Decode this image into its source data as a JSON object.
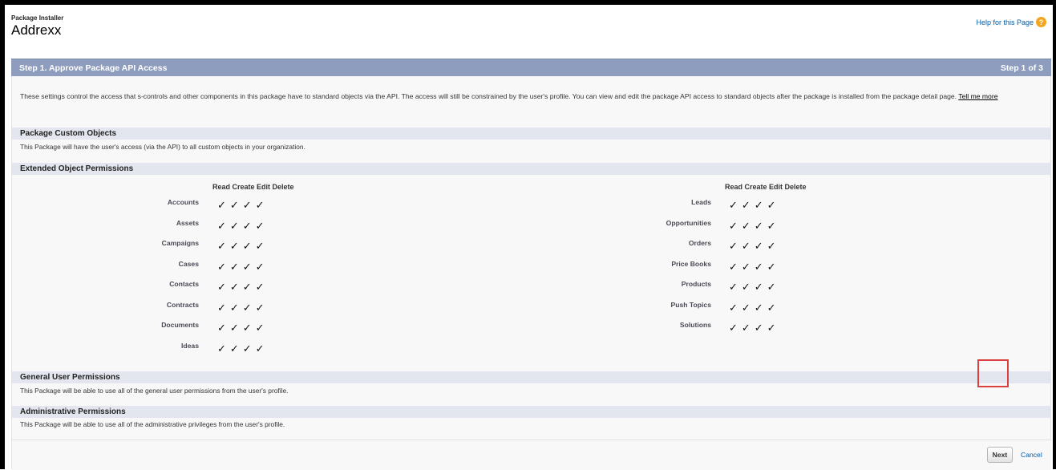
{
  "header": {
    "breadcrumb": "Package Installer",
    "title": "Addrexx",
    "help_link": "Help for this Page",
    "help_icon": "?"
  },
  "step": {
    "label": "Step 1. Approve Package API Access",
    "counter": "Step 1 of 3"
  },
  "intro": {
    "text": "These settings control the access that s-controls and other components in this package have to standard objects via the API. The access will still be constrained by the user's profile. You can view and edit the package API access to standard objects after the package is installed from the package detail page.",
    "link": "Tell me more"
  },
  "sections": {
    "custom_objects": {
      "title": "Package Custom Objects",
      "text": "This Package will have the user's access (via the API) to all custom objects in your organization."
    },
    "extended": {
      "title": "Extended Object Permissions",
      "columns_header": "Read Create Edit Delete"
    },
    "general": {
      "title": "General User Permissions",
      "text": "This Package will be able to use all of the general user permissions from the user's profile."
    },
    "admin": {
      "title": "Administrative Permissions",
      "text": "This Package will be able to use all of the administrative privileges from the user's profile."
    }
  },
  "permissions_left": [
    {
      "name": "Accounts",
      "checks": "✓✓✓✓"
    },
    {
      "name": "Assets",
      "checks": "✓✓✓✓"
    },
    {
      "name": "Campaigns",
      "checks": "✓✓✓✓"
    },
    {
      "name": "Cases",
      "checks": "✓✓✓✓"
    },
    {
      "name": "Contacts",
      "checks": "✓✓✓✓"
    },
    {
      "name": "Contracts",
      "checks": "✓✓✓✓"
    },
    {
      "name": "Documents",
      "checks": "✓✓✓✓"
    },
    {
      "name": "Ideas",
      "checks": "✓✓✓✓"
    }
  ],
  "permissions_right": [
    {
      "name": "Leads",
      "checks": "✓✓✓✓"
    },
    {
      "name": "Opportunities",
      "checks": "✓✓✓✓"
    },
    {
      "name": "Orders",
      "checks": "✓✓✓✓"
    },
    {
      "name": "Price Books",
      "checks": "✓✓✓✓"
    },
    {
      "name": "Products",
      "checks": "✓✓✓✓"
    },
    {
      "name": "Push Topics",
      "checks": "✓✓✓✓"
    },
    {
      "name": "Solutions",
      "checks": "✓✓✓✓"
    }
  ],
  "footer": {
    "next_label": "Next",
    "cancel_label": "Cancel"
  },
  "colors": {
    "step_bar": "#8e9dbe",
    "section_header": "#e3e6ee",
    "link": "#015ba7",
    "highlight": "#d94040"
  }
}
